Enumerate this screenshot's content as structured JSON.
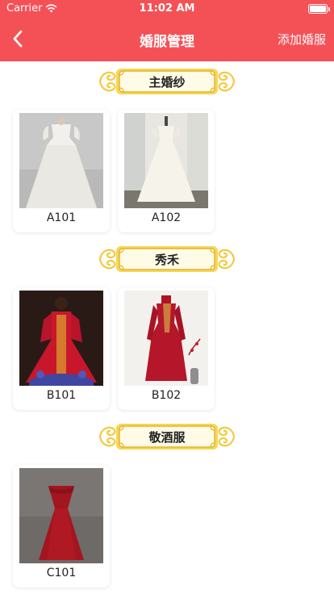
{
  "status": {
    "carrier": "Carrier",
    "time": "11:02 AM"
  },
  "nav": {
    "title": "婚服管理",
    "add_label": "添加婚服",
    "back_icon": "chevron-left-icon"
  },
  "colors": {
    "header": "#f45157",
    "frame_gold": "#f3c93b",
    "frame_fill": "#fff6c8"
  },
  "sections": [
    {
      "title": "主婚纱",
      "items": [
        {
          "code": "A101"
        },
        {
          "code": "A102"
        }
      ]
    },
    {
      "title": "秀禾",
      "items": [
        {
          "code": "B101"
        },
        {
          "code": "B102"
        }
      ]
    },
    {
      "title": "敬酒服",
      "items": [
        {
          "code": "C101"
        }
      ]
    }
  ]
}
